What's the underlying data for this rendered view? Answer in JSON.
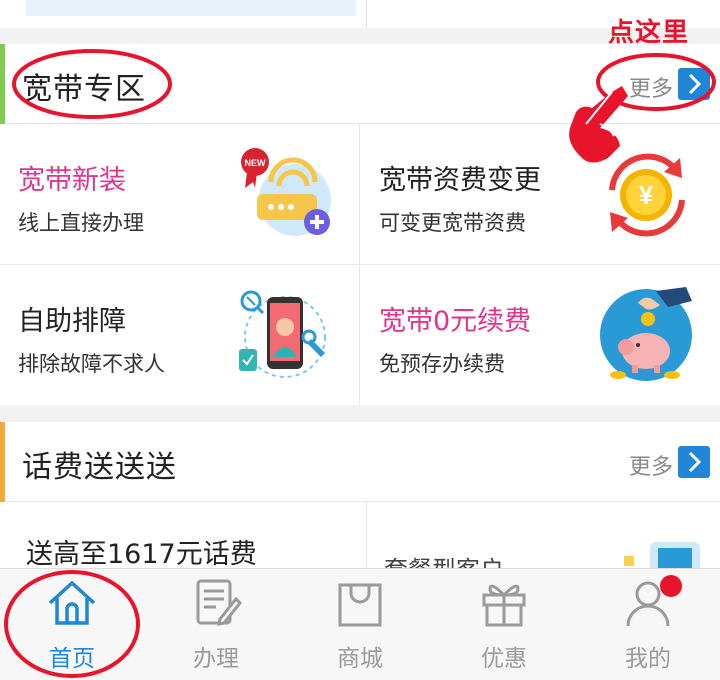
{
  "broadband": {
    "title": "宽带专区",
    "more_label": "更多",
    "accent_color": "#7ecb4f",
    "items": [
      {
        "title": "宽带新装",
        "subtitle": "线上直接办理",
        "title_color": "#e0358f",
        "icon": "new-router-icon"
      },
      {
        "title": "宽带资费变更",
        "subtitle": "可变更宽带资费",
        "title_color": "#222222",
        "icon": "yuan-coin-exchange-icon"
      },
      {
        "title": "自助排障",
        "subtitle": "排除故障不求人",
        "title_color": "#222222",
        "icon": "phone-repair-icon"
      },
      {
        "title": "宽带0元续费",
        "subtitle": "免预存办续费",
        "title_color": "#e0358f",
        "icon": "piggy-bank-icon"
      }
    ]
  },
  "topup": {
    "title": "话费送送送",
    "more_label": "更多",
    "accent_color": "#f2a93b",
    "left_text": "送高至1617元话费",
    "right_text": "套餐型客户"
  },
  "annotation": {
    "text": "点这里",
    "color": "#e8142b"
  },
  "tabbar": {
    "active_color": "#1f86d8",
    "tabs": [
      {
        "label": "首页",
        "icon": "home-icon",
        "active": true
      },
      {
        "label": "办理",
        "icon": "document-edit-icon",
        "active": false
      },
      {
        "label": "商城",
        "icon": "shopping-bag-icon",
        "active": false
      },
      {
        "label": "优惠",
        "icon": "gift-icon",
        "active": false
      },
      {
        "label": "我的",
        "icon": "user-icon",
        "active": false,
        "badge": true
      }
    ]
  }
}
